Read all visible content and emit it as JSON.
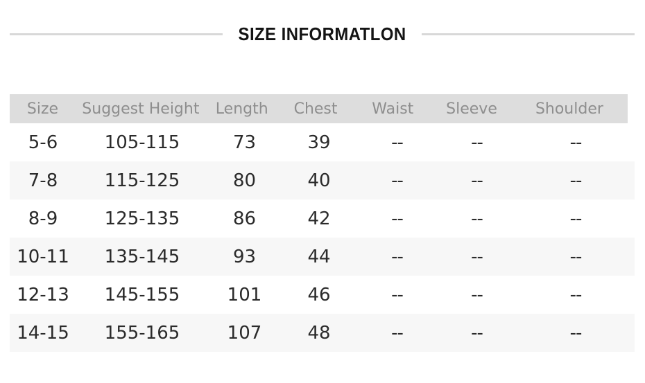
{
  "title": "SIZE INFORMATLON",
  "colors": {
    "header_band": "#dddddd",
    "header_text": "#8e8e8e",
    "row_alt": "#f7f7f7",
    "row_base": "#ffffff",
    "body_text": "#2b2b2b",
    "title_text": "#141414",
    "rule": "#d8d8d8"
  },
  "table": {
    "columns": [
      {
        "key": "size",
        "label": "Size"
      },
      {
        "key": "height",
        "label": "Suggest Height"
      },
      {
        "key": "length",
        "label": "Length"
      },
      {
        "key": "chest",
        "label": "Chest"
      },
      {
        "key": "waist",
        "label": "Waist"
      },
      {
        "key": "sleeve",
        "label": "Sleeve"
      },
      {
        "key": "shoulder",
        "label": "Shoulder"
      }
    ],
    "rows": [
      {
        "size": "5-6",
        "height": "105-115",
        "length": "73",
        "chest": "39",
        "waist": "--",
        "sleeve": "--",
        "shoulder": "--"
      },
      {
        "size": "7-8",
        "height": "115-125",
        "length": "80",
        "chest": "40",
        "waist": "--",
        "sleeve": "--",
        "shoulder": "--"
      },
      {
        "size": "8-9",
        "height": "125-135",
        "length": "86",
        "chest": "42",
        "waist": "--",
        "sleeve": "--",
        "shoulder": "--"
      },
      {
        "size": "10-11",
        "height": "135-145",
        "length": "93",
        "chest": "44",
        "waist": "--",
        "sleeve": "--",
        "shoulder": "--"
      },
      {
        "size": "12-13",
        "height": "145-155",
        "length": "101",
        "chest": "46",
        "waist": "--",
        "sleeve": "--",
        "shoulder": "--"
      },
      {
        "size": "14-15",
        "height": "155-165",
        "length": "107",
        "chest": "48",
        "waist": "--",
        "sleeve": "--",
        "shoulder": "--"
      }
    ]
  }
}
